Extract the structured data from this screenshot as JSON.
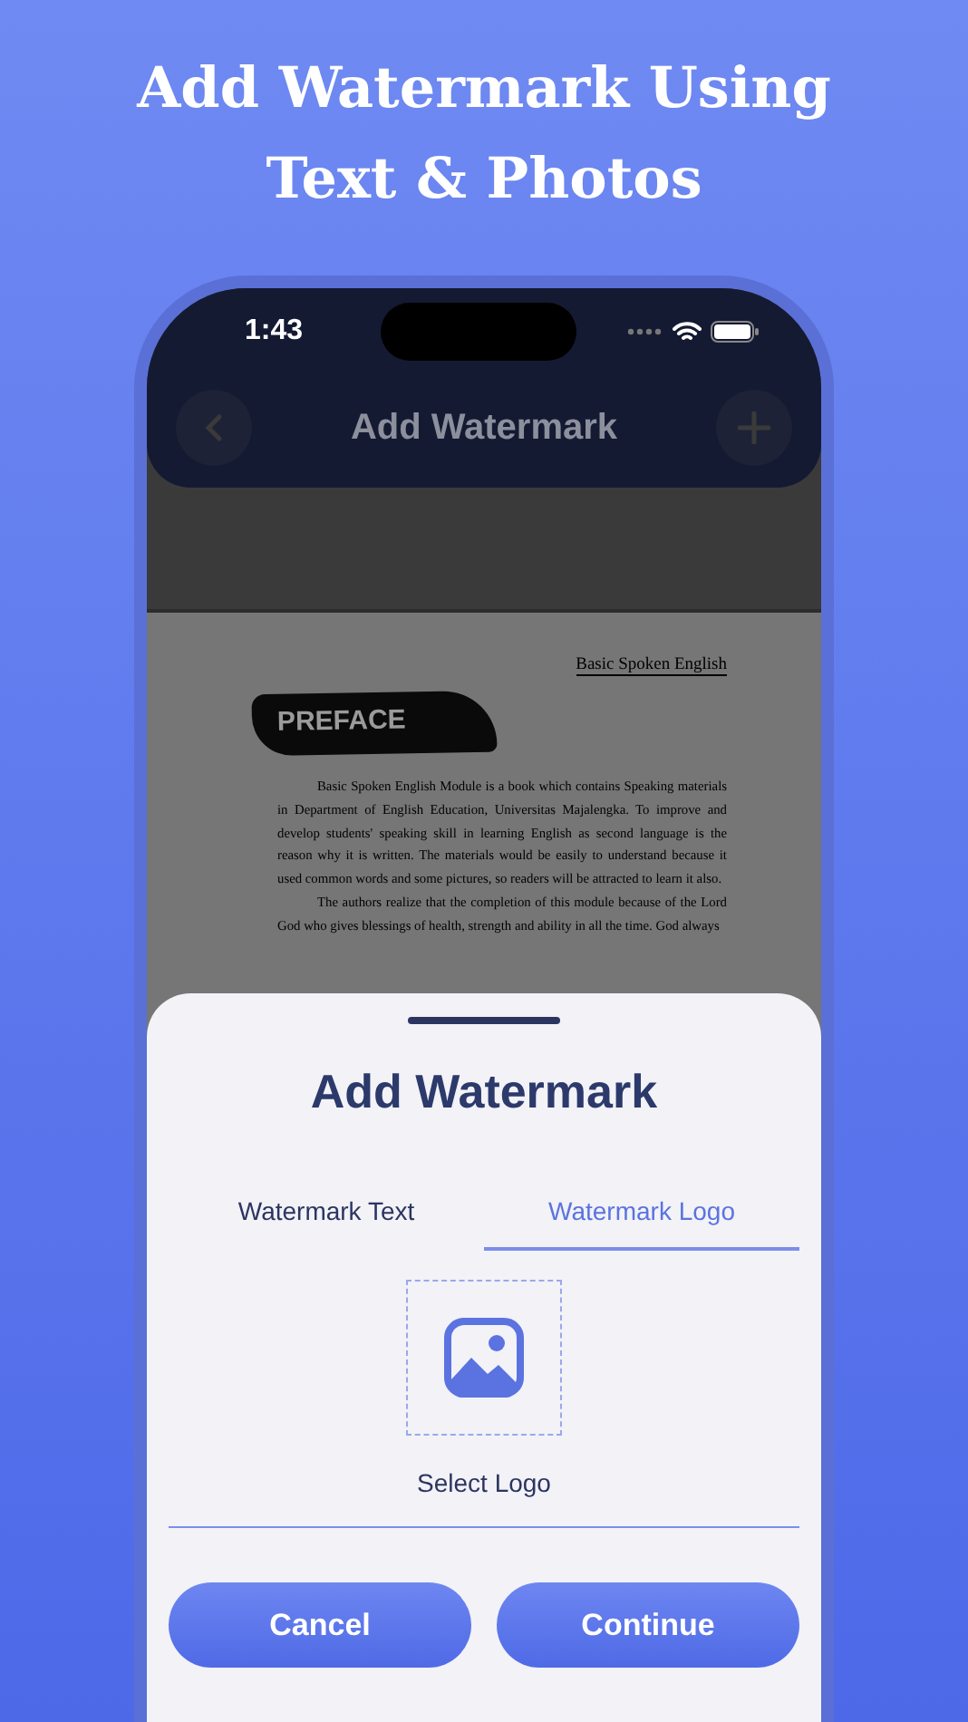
{
  "headline": [
    "Add Watermark Using",
    "Text & Photos"
  ],
  "status_bar": {
    "time": "1:43"
  },
  "nav": {
    "title": "Add Watermark"
  },
  "document": {
    "header": "Basic Spoken English",
    "heading": "PREFACE",
    "paragraphs": [
      "Basic Spoken English Module is a book which contains Speaking materials in Department of English Education, Universitas Majalengka. To improve and develop students' speaking skill in learning English as second language is the reason why it is written. The materials would be easily to understand because it used common words and some pictures, so readers will be attracted to learn it also.",
      "The authors realize that the completion of this module because of the Lord God who gives blessings of health, strength and ability in all the time. God always"
    ]
  },
  "sheet": {
    "title": "Add Watermark",
    "tabs": [
      {
        "label": "Watermark Text",
        "selected": false
      },
      {
        "label": "Watermark Logo",
        "selected": true
      }
    ],
    "logo_picker": {
      "label": "Select Logo"
    },
    "buttons": [
      {
        "label": "Cancel"
      },
      {
        "label": "Continue"
      }
    ]
  }
}
